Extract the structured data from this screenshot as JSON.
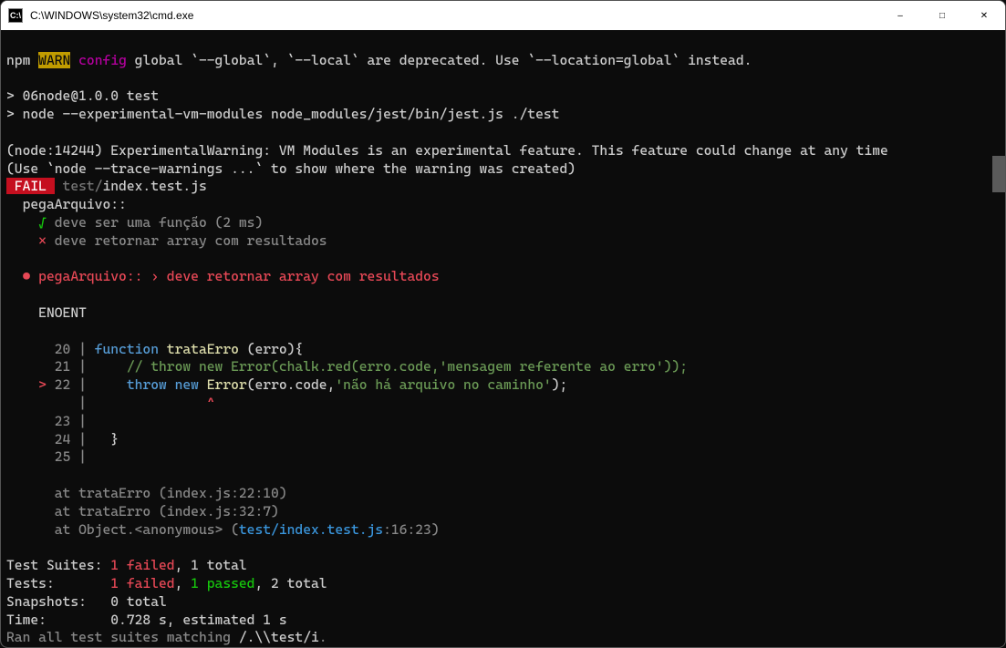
{
  "titlebar": {
    "path": "C:\\WINDOWS\\system32\\cmd.exe",
    "icon_label": "C:\\"
  },
  "npm_line": {
    "npm": "npm",
    "warn": "WARN",
    "config": "config",
    "rest": " global `--global`, `--local` are deprecated. Use `--location=global` instead."
  },
  "script_header": {
    "l1": "> 06node@1.0.0 test",
    "l2": "> node --experimental-vm-modules node_modules/jest/bin/jest.js ./test"
  },
  "warn": {
    "l1": "(node:14244) ExperimentalWarning: VM Modules is an experimental feature. This feature could change at any time",
    "l2": "(Use `node --trace-warnings ...` to show where the warning was created)"
  },
  "fail": {
    "badge": " FAIL ",
    "dir": " test/",
    "file": "index.test.js"
  },
  "describe": "  pegaArquivo::",
  "test_pass": {
    "check": "    √",
    "name": " deve ser uma função (2 ms)"
  },
  "test_fail": {
    "x": "    ×",
    "name": " deve retornar array com resultados"
  },
  "fail_header": {
    "bullet": "  ●",
    "text": " pegaArquivo:: › deve retornar array com resultados"
  },
  "enoent": "    ENOENT",
  "code": {
    "l20": {
      "num": "      20",
      "pipe": " |",
      "pre": " ",
      "kw": "function",
      "fn": " trataErro ",
      "rest": "(erro){"
    },
    "l21": {
      "num": "      21",
      "pipe": " |",
      "comment": "     // throw new Error(chalk.red(erro.code,'mensagem referente ao erro'));"
    },
    "l22": {
      "arrow": "    >",
      "num": " 22",
      "pipe": " |",
      "pre": "     ",
      "throw": "throw new ",
      "err": "Error",
      "open": "(erro.code,",
      "str": "'não há arquivo no caminho'",
      "close": ");"
    },
    "caret": {
      "pre": "        ",
      "pipe": " |",
      "pad": "               ",
      "c": "^"
    },
    "l23": {
      "num": "      23",
      "pipe": " |"
    },
    "l24": {
      "num": "      24",
      "pipe": " |",
      "body": "   }"
    },
    "l25": {
      "num": "      25",
      "pipe": " |"
    }
  },
  "stack": {
    "l1a": "      at trataErro (",
    "l1b": "index.js",
    "l1c": ":22:10)",
    "l2a": "      at trataErro (",
    "l2b": "index.js",
    "l2c": ":32:7)",
    "l3a": "      at Object.<anonymous> (",
    "l3b": "test/index.test.js",
    "l3c": ":16:23)"
  },
  "summary": {
    "suites_lbl": "Test Suites: ",
    "suites_fail": "1 failed",
    "suites_rest": ", 1 total",
    "tests_lbl": "Tests:       ",
    "tests_fail": "1 failed",
    "tests_mid": ", ",
    "tests_pass": "1 passed",
    "tests_rest": ", 2 total",
    "snap_lbl": "Snapshots:   ",
    "snap_val": "0 total",
    "time_lbl": "Time:        ",
    "time_val": "0.728 s, estimated 1 s",
    "ran1": "Ran all test suites matching ",
    "ran2": "/.\\\\test/i",
    "ran3": "."
  }
}
